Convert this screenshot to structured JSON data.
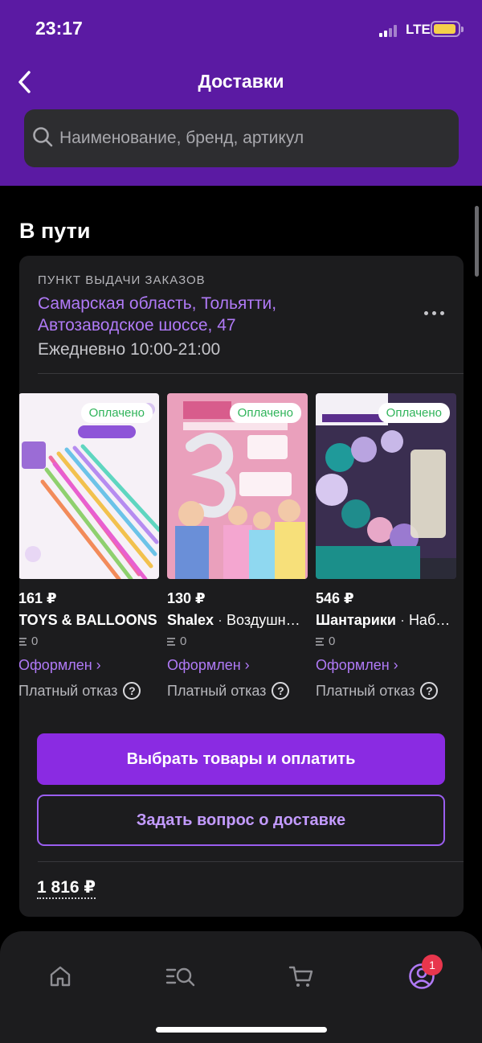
{
  "status_bar": {
    "time": "23:17",
    "network": "LTE"
  },
  "header": {
    "title": "Доставки"
  },
  "search": {
    "placeholder": "Наименование, бренд, артикул"
  },
  "section": {
    "title": "В пути"
  },
  "pickup": {
    "label": "ПУНКТ ВЫДАЧИ ЗАКАЗОВ",
    "address": "Самарская область, Тольятти, Автозаводское шоссе, 47",
    "hours": "Ежедневно 10:00-21:00"
  },
  "products": [
    {
      "badge": "Оплачено",
      "price": "161 ₽",
      "brand": "TOYS & BALLOONS",
      "name": "",
      "count": "0",
      "status": "Оформлен ›",
      "refund": "Платный отказ",
      "thumb_colors": [
        "#f4eff6",
        "#c9a8e8"
      ]
    },
    {
      "badge": "Оплачено",
      "price": "130 ₽",
      "brand": "Shalex",
      "name": "Воздушные шары",
      "count": "0",
      "status": "Оформлен ›",
      "refund": "Платный отказ",
      "thumb_colors": [
        "#e996b4",
        "#d65f88"
      ]
    },
    {
      "badge": "Оплачено",
      "price": "546 ₽",
      "brand": "Шантарики",
      "name": "Набор воздушных шаров",
      "count": "0",
      "status": "Оформлен ›",
      "refund": "Платный отказ",
      "thumb_colors": [
        "#3b2a58",
        "#1f8c8c"
      ]
    }
  ],
  "actions": {
    "primary": "Выбрать товары и оплатить",
    "secondary": "Задать вопрос о доставке"
  },
  "total": "1 816 ₽",
  "tabbar": {
    "profile_badge": "1"
  },
  "colors": {
    "header": "#5b1aa3",
    "accent": "#8a2be2",
    "link": "#b07af7",
    "paid": "#30b45a",
    "badge": "#e8364d"
  }
}
